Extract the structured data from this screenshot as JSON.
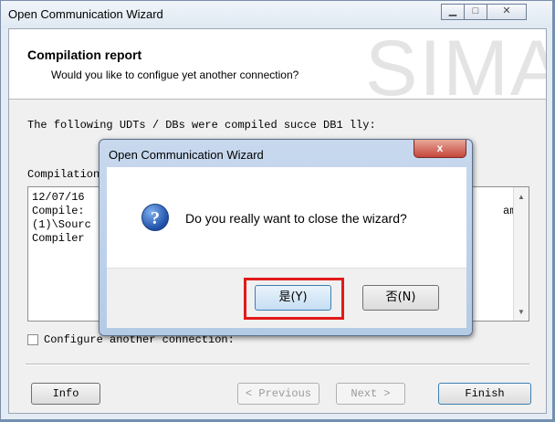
{
  "window": {
    "title": "Open Communication Wizard",
    "min_icon": "minimize-icon",
    "max_icon": "maximize-icon",
    "close_icon": "close-icon"
  },
  "header": {
    "title": "Compilation report",
    "subtitle": "Would you like to configue yet another connection?",
    "watermark": "SIMA"
  },
  "body": {
    "message": "The following UDTs / DBs were compiled succe DB1 lly:",
    "status_label": "Compilation",
    "log_lines": [
      "12/07/16",
      "Compile:",
      "(1)\\Sourc",
      "Compiler"
    ],
    "log_right_fragment": "am",
    "checkbox_label": "Configure another connection:"
  },
  "footer": {
    "info": "Info",
    "previous": "< Previous",
    "next": "Next >",
    "finish": "Finish"
  },
  "dialog": {
    "title": "Open Communication Wizard",
    "close_glyph": "x",
    "icon": "question-icon",
    "icon_glyph": "?",
    "message": "Do you really want to close the wizard?",
    "yes_label": "是(Y)",
    "no_label": "否(N)",
    "highlight_color": "#e21a1a"
  }
}
